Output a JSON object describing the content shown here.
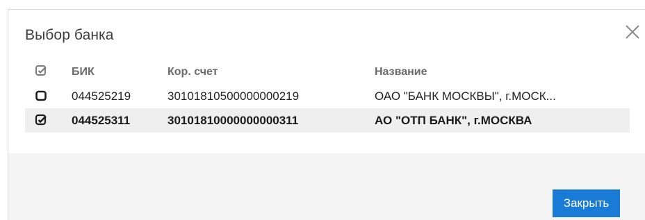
{
  "dialog": {
    "title": "Выбор банка",
    "close_icon": "close-icon"
  },
  "table": {
    "columns": {
      "select": "checkbox-icon",
      "bik": "БИК",
      "account": "Кор. счет",
      "name": "Название"
    },
    "rows": [
      {
        "checked": false,
        "bik": "044525219",
        "account": "30101810500000000219",
        "name": "ОАО \"БАНК МОСКВЫ\", г.МОСК..."
      },
      {
        "checked": true,
        "bik": "044525311",
        "account": "30101810000000000311",
        "name": "АО \"ОТП БАНК\", г.МОСКВА"
      }
    ]
  },
  "footer": {
    "close_label": "Закрыть"
  },
  "colors": {
    "accent": "#1a7bd6",
    "selected_row": "#efefef",
    "footer_bg": "#f4f4f4"
  }
}
